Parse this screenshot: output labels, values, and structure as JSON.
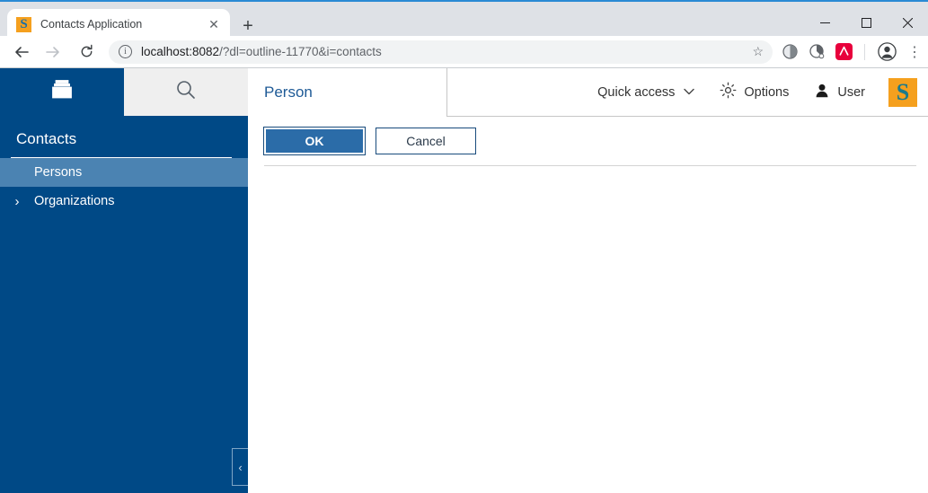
{
  "browser": {
    "tab": {
      "title": "Contacts Application",
      "favicon_letter": "S",
      "favicon_bg": "#f5a01e",
      "favicon_fg": "#1a6fa8",
      "close_label": "✕"
    },
    "newtab_label": "+",
    "window_controls": {
      "minimize": "minimize-icon",
      "maximize": "maximize-icon",
      "close": "close-icon"
    },
    "toolbar": {
      "back": "back-arrow-icon",
      "forward": "forward-arrow-icon",
      "reload": "reload-icon",
      "site_info": "i",
      "url_host": "localhost:8082",
      "url_path": "/?dl=outline-11770&i=contacts",
      "bookmark": "☆",
      "extensions": [
        "extension-icon-1",
        "extension-icon-2",
        "extension-icon-3"
      ],
      "profile": "profile-avatar-icon",
      "menu": "⋮"
    }
  },
  "sidebar": {
    "tabs": [
      {
        "name": "archive-box",
        "active": false
      },
      {
        "name": "search",
        "active": true
      }
    ],
    "title": "Contacts",
    "nav_items": [
      {
        "label": "Persons",
        "chevron": "",
        "selected": true
      },
      {
        "label": "Organizations",
        "chevron": "›",
        "selected": false
      }
    ],
    "collapse_label": "‹",
    "bg_color": "#004986",
    "selected_color": "#4b83b2"
  },
  "app_header": {
    "page_title": "Person",
    "quick_access": {
      "label": "Quick access",
      "caret": "⌄"
    },
    "options": {
      "label": "Options",
      "icon": "gear-icon"
    },
    "user": {
      "label": "User",
      "icon": "person-icon"
    },
    "logo": {
      "letter": "S",
      "bg": "#f5a01e",
      "fg": "#1b7a8c"
    }
  },
  "form": {
    "ok_label": "OK",
    "cancel_label": "Cancel"
  }
}
